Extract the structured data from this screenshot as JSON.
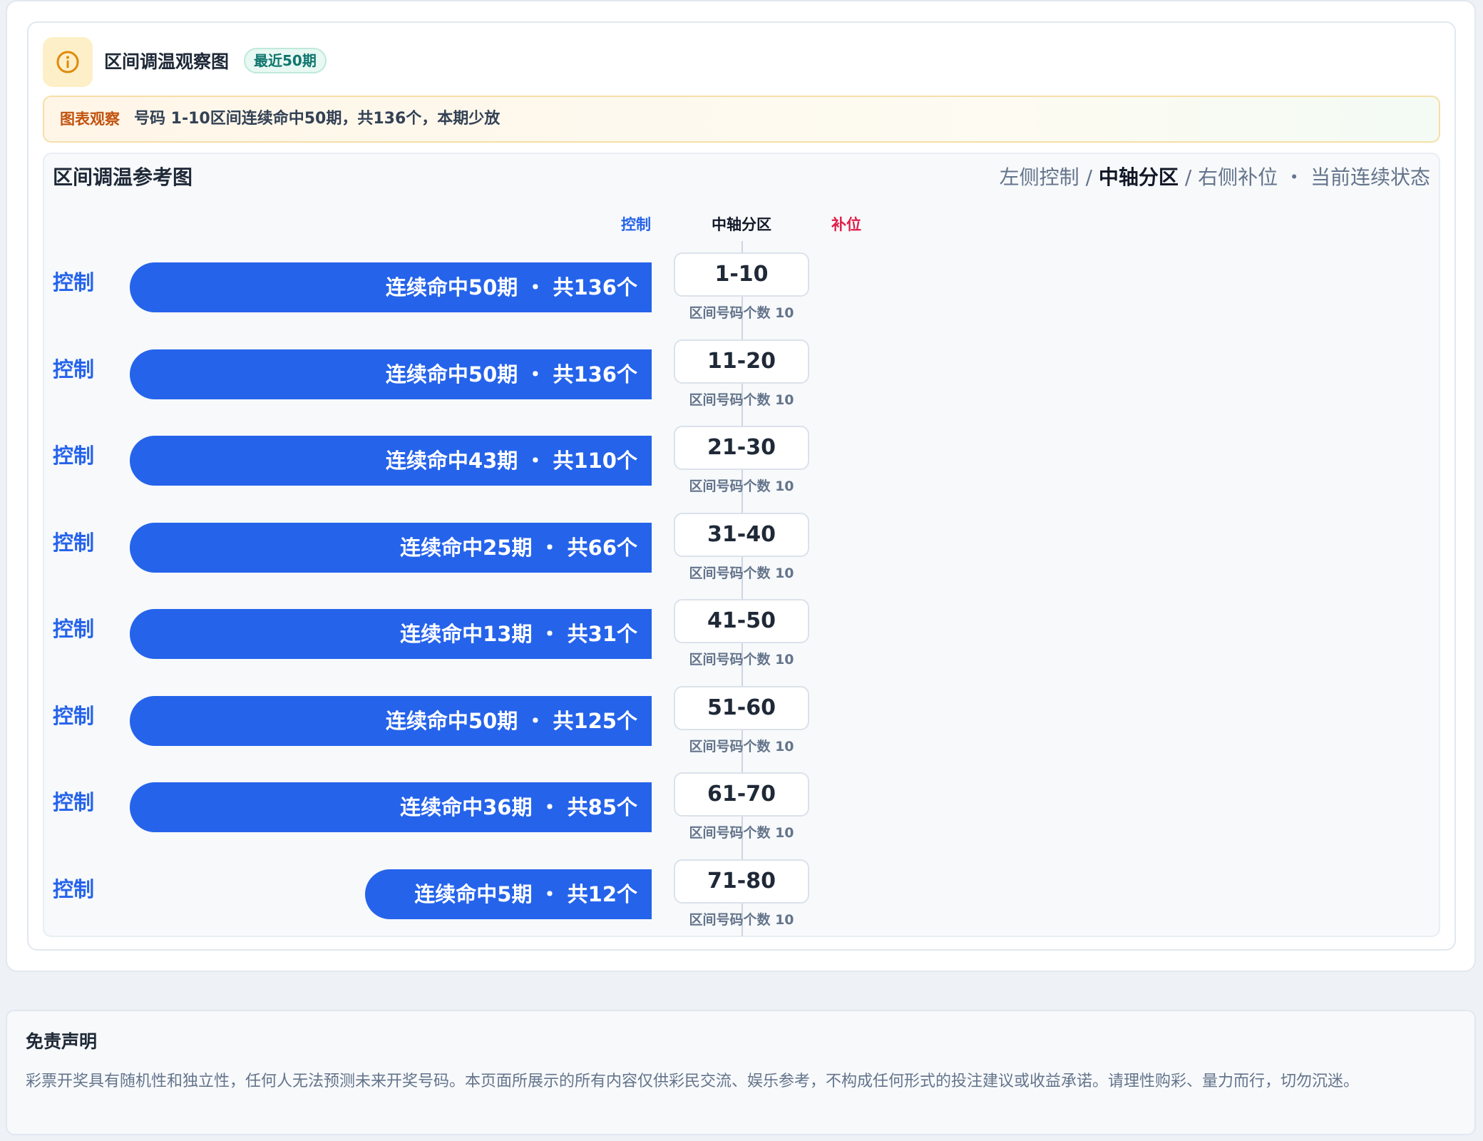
{
  "header": {
    "title": "区间调温观察图",
    "badge": "最近50期"
  },
  "observation": {
    "label": "图表观察",
    "text": "号码 1-10区间连续命中50期，共136个，本期少放"
  },
  "chart_panel": {
    "title": "区间调温参考图",
    "legend": {
      "left": "左侧控制",
      "sep1": " / ",
      "mid": "中轴分区",
      "sep2": " / ",
      "right": "右侧补位",
      "dot": " ・ ",
      "state": "当前连续状态"
    },
    "col_heads": {
      "left": "控制",
      "mid": "中轴分区",
      "right": "补位"
    }
  },
  "colors": {
    "control": "#2563eb",
    "fill": "#e11d48",
    "badge_text": "#0f766e",
    "observation_label": "#c2530f"
  },
  "icons": {
    "header": "info-icon"
  },
  "chart_data": {
    "type": "bar",
    "orientation": "horizontal",
    "title": "区间调温参考图",
    "x_max_streak": 50,
    "rows": [
      {
        "range": "1-10",
        "side": "控制",
        "streak": 50,
        "total": 136,
        "label": "连续命中50期 ・ 共136个",
        "count_label": "区间号码个数 10"
      },
      {
        "range": "11-20",
        "side": "控制",
        "streak": 50,
        "total": 136,
        "label": "连续命中50期 ・ 共136个",
        "count_label": "区间号码个数 10"
      },
      {
        "range": "21-30",
        "side": "控制",
        "streak": 43,
        "total": 110,
        "label": "连续命中43期 ・ 共110个",
        "count_label": "区间号码个数 10"
      },
      {
        "range": "31-40",
        "side": "控制",
        "streak": 25,
        "total": 66,
        "label": "连续命中25期 ・ 共66个",
        "count_label": "区间号码个数 10"
      },
      {
        "range": "41-50",
        "side": "控制",
        "streak": 13,
        "total": 31,
        "label": "连续命中13期 ・ 共31个",
        "count_label": "区间号码个数 10"
      },
      {
        "range": "51-60",
        "side": "控制",
        "streak": 50,
        "total": 125,
        "label": "连续命中50期 ・ 共125个",
        "count_label": "区间号码个数 10"
      },
      {
        "range": "61-70",
        "side": "控制",
        "streak": 36,
        "total": 85,
        "label": "连续命中36期 ・ 共85个",
        "count_label": "区间号码个数 10"
      },
      {
        "range": "71-80",
        "side": "控制",
        "streak": 5,
        "total": 12,
        "label": "连续命中5期 ・ 共12个",
        "count_label": "区间号码个数 10"
      }
    ]
  },
  "disclaimer": {
    "title": "免责声明",
    "text": "彩票开奖具有随机性和独立性，任何人无法预测未来开奖号码。本页面所展示的所有内容仅供彩民交流、娱乐参考，不构成任何形式的投注建议或收益承诺。请理性购彩、量力而行，切勿沉迷。"
  }
}
